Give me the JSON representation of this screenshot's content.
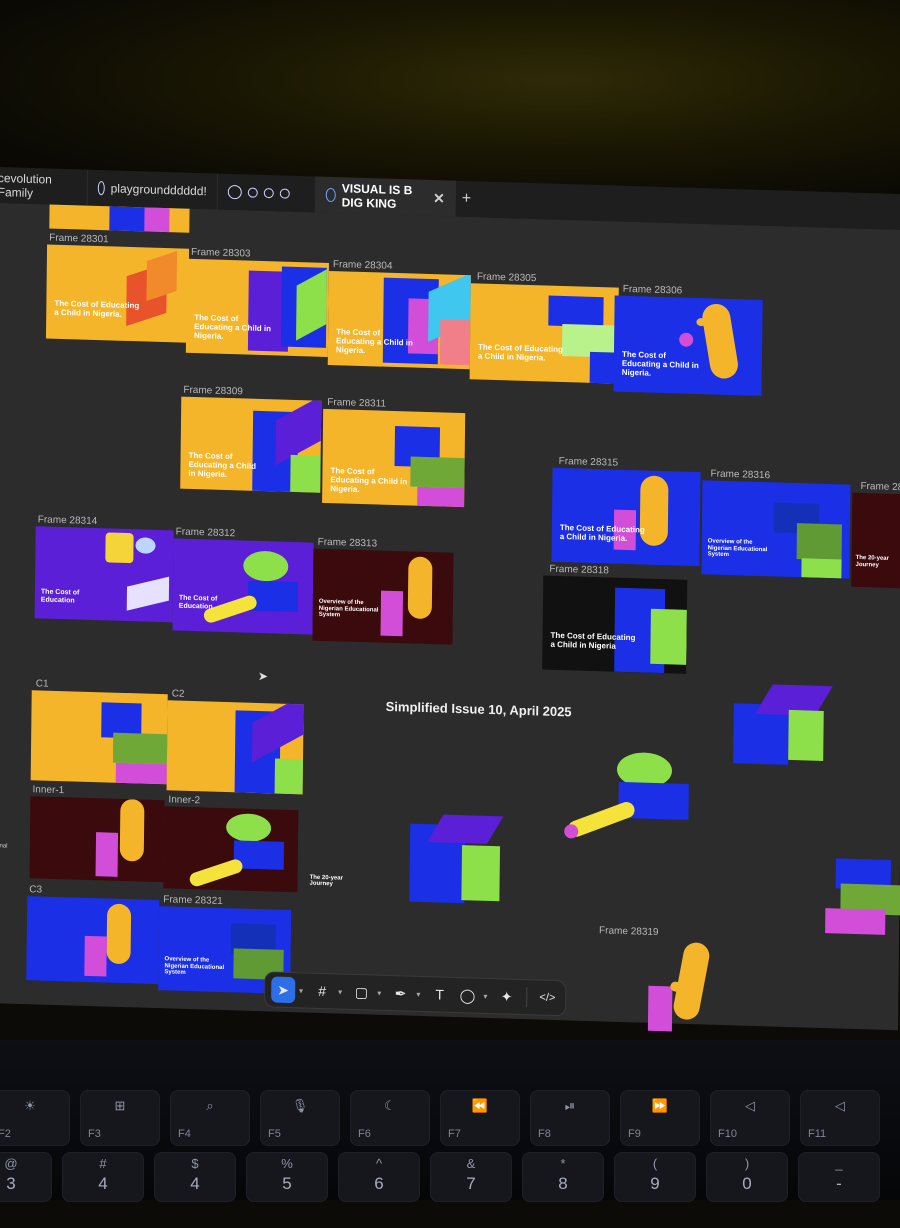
{
  "tabs": [
    {
      "label": "cevolution Family"
    },
    {
      "label": "playgroundddddd!"
    },
    {
      "label": ""
    },
    {
      "label": "VISUAL IS B DIG KING"
    }
  ],
  "frames": [
    {
      "label": "Frame 28301",
      "text": "The Cost of Educating a Child in Nigeria."
    },
    {
      "label": "Frame 28303",
      "text": "The Cost of Educating a Child in Nigeria."
    },
    {
      "label": "Frame 28304",
      "text": "The Cost of Educating a Child in Nigeria."
    },
    {
      "label": "Frame 28305",
      "text": "The Cost of Educating a Child in Nigeria."
    },
    {
      "label": "Frame 28306",
      "text": "The Cost of Educating a Child in Nigeria."
    },
    {
      "label": "Frame 28309",
      "text": "The Cost of Educating a Child in Nigeria."
    },
    {
      "label": "Frame 28311",
      "text": "The Cost of Educating a Child in Nigeria."
    },
    {
      "label": "Frame 28315",
      "text": "The Cost of Educating a Child in Nigeria."
    },
    {
      "label": "Frame 28316",
      "text": "Overview of the Nigerian Educational System"
    },
    {
      "label": "Frame 28",
      "text": "The 20-year Journey"
    },
    {
      "label": "Frame 28314",
      "text": "The Cost of Education"
    },
    {
      "label": "Frame 28312",
      "text": "The Cost of Education"
    },
    {
      "label": "Frame 28313",
      "text": "Overview of the Nigerian Educational System"
    },
    {
      "label": "Frame 28318",
      "text": "The Cost of Educating a Child in Nigeria"
    },
    {
      "label": "C1",
      "text": ""
    },
    {
      "label": "C2",
      "text": ""
    },
    {
      "label": "Inner-1",
      "text": ""
    },
    {
      "label": "Inner-2",
      "text": ""
    },
    {
      "label": "C3",
      "text": ""
    },
    {
      "label": "Frame 28321",
      "text": "Overview of the Nigerian Educational System"
    },
    {
      "label": "Frame 28319",
      "text": ""
    }
  ],
  "canvas": {
    "title": "Simplified Issue 10, April 2025",
    "floating_text": "The 20-year Journey",
    "edge_text": "ational"
  },
  "colors": {
    "yellow": "#f5b52a",
    "blue": "#1b2fe6",
    "purple": "#5a1fd6",
    "maroon": "#3a0a0c",
    "black": "#111111",
    "green": "#8ee04a",
    "pink": "#d24ed9",
    "toolbar_active": "#2d6fe8"
  },
  "toolbar": {
    "tools": [
      "move-icon",
      "frame-icon",
      "shape-icon",
      "pen-icon",
      "text-icon",
      "comment-icon",
      "actions-icon",
      "code-icon"
    ]
  },
  "keyboard": {
    "fkeys": [
      "F2",
      "F3",
      "F4",
      "F5",
      "F6",
      "F7",
      "F8",
      "F9",
      "F10",
      "F11"
    ],
    "numkeys": [
      {
        "top": "@",
        "bottom": "3"
      },
      {
        "top": "#",
        "bottom": "4"
      },
      {
        "top": "$",
        "bottom": "4"
      },
      {
        "top": "%",
        "bottom": "5"
      },
      {
        "top": "^",
        "bottom": "6"
      },
      {
        "top": "&",
        "bottom": "7"
      },
      {
        "top": "*",
        "bottom": "8"
      },
      {
        "top": "(",
        "bottom": "9"
      },
      {
        "top": ")",
        "bottom": "0"
      },
      {
        "top": "_",
        "bottom": "-"
      }
    ]
  }
}
